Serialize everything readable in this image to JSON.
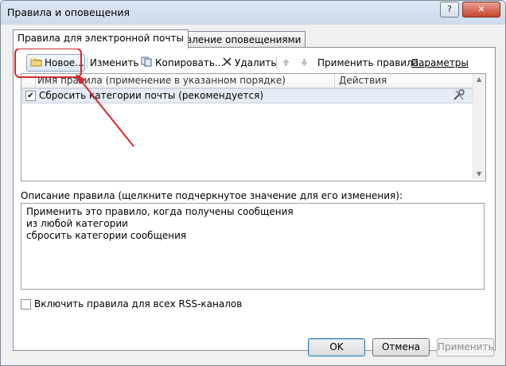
{
  "window": {
    "title": "Правила и оповещения",
    "help_button": "?",
    "close_button": "✕"
  },
  "tabs": [
    {
      "label": "Правила для электронной почты",
      "active": true
    },
    {
      "label": "Управление оповещениями",
      "active": false
    }
  ],
  "toolbar": {
    "new": "Новое...",
    "change": "Изменить",
    "copy": "Копировать...",
    "delete": "Удалить",
    "apply_rules": "Применить правила...",
    "params": "Параметры"
  },
  "rules_list": {
    "columns": [
      "Имя правила (применение в указанном порядке)",
      "Действия"
    ],
    "rows": [
      {
        "checked": true,
        "name": "Сбросить категории почты (рекомендуется)"
      }
    ]
  },
  "description": {
    "label": "Описание правила (щелкните подчеркнутое значение для его изменения):",
    "lines": [
      "Применить это правило, когда получены сообщения",
      "из любой категории",
      "сбросить категории сообщения"
    ]
  },
  "rss_checkbox": {
    "label": "Включить правила для всех RSS-каналов",
    "checked": false
  },
  "buttons": {
    "ok": "OK",
    "cancel": "Отмена",
    "apply": "Применить"
  },
  "colors": {
    "highlight": "#d12b2b",
    "accent": "#3c7fb1"
  }
}
